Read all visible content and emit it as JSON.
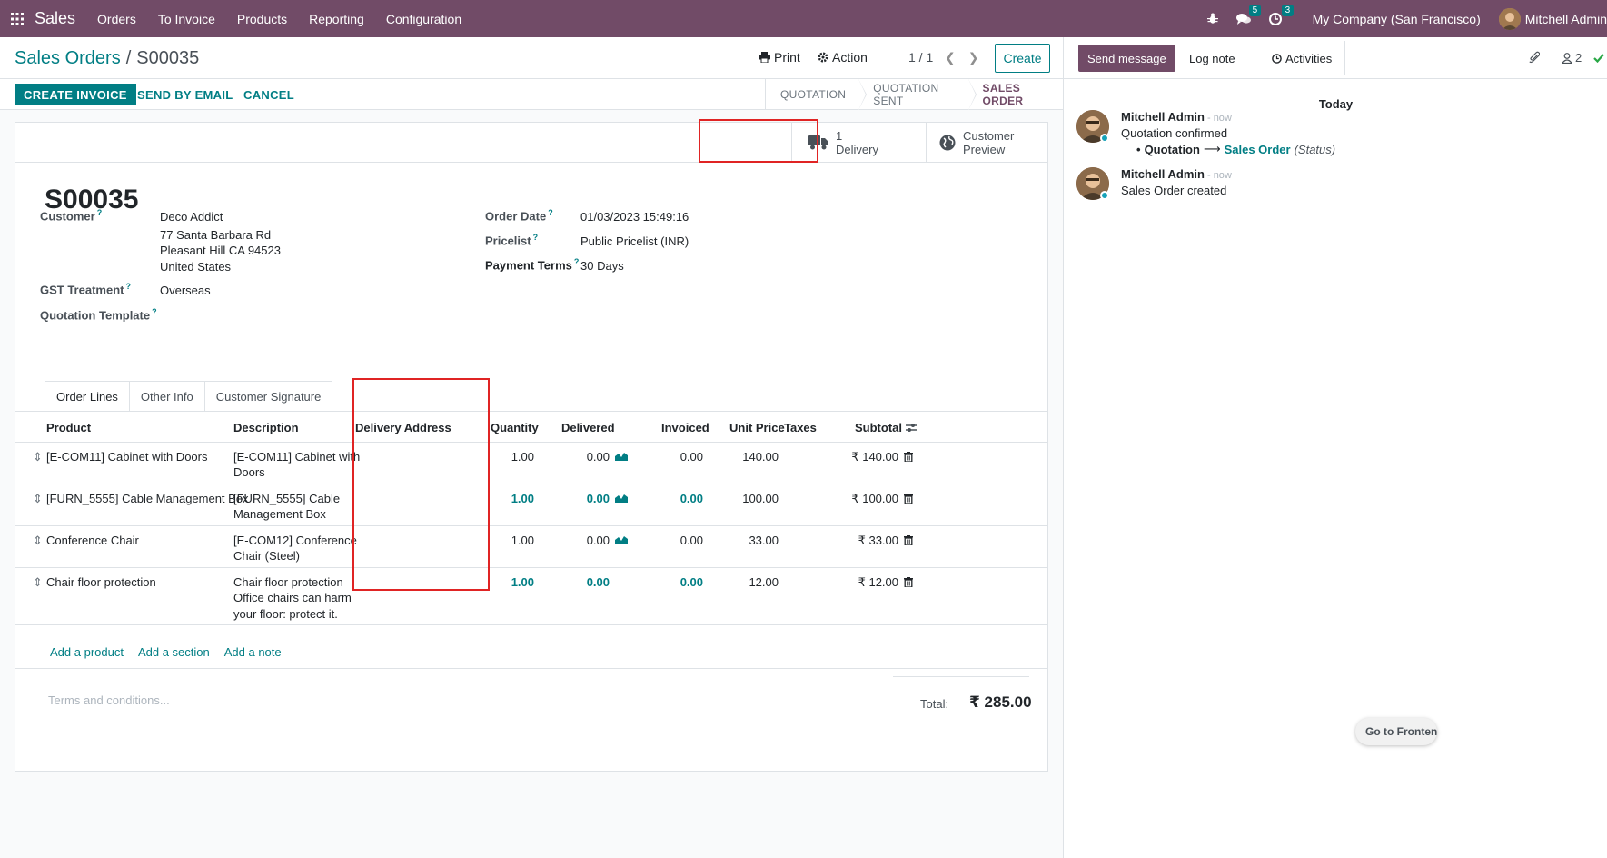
{
  "navbar": {
    "app_name": "Sales",
    "menu": [
      "Orders",
      "To Invoice",
      "Products",
      "Reporting",
      "Configuration"
    ],
    "messages_count": "5",
    "activities_count": "3",
    "company": "My Company (San Francisco)",
    "user": "Mitchell Admin",
    "brand_color": "#714b67"
  },
  "control_panel": {
    "breadcrumb_parent": "Sales Orders",
    "breadcrumb_sep": "/",
    "breadcrumb_current": "S00035",
    "print_label": "Print",
    "action_label": "Action",
    "pager": "1 / 1",
    "create_label": "Create"
  },
  "statusbar": {
    "create_invoice": "CREATE INVOICE",
    "send_by_email": "SEND BY EMAIL",
    "cancel": "CANCEL",
    "stages": [
      "QUOTATION",
      "QUOTATION SENT",
      "SALES ORDER"
    ],
    "active_stage": "SALES ORDER"
  },
  "smart_buttons": {
    "delivery_count": "1",
    "delivery_label": "Delivery",
    "preview_line1": "Customer",
    "preview_line2": "Preview"
  },
  "form": {
    "order_name": "S00035",
    "customer_label": "Customer",
    "customer_name": "Deco Addict",
    "address_line1": "77 Santa Barbara Rd",
    "address_line2": "Pleasant Hill CA 94523",
    "address_line3": "United States",
    "gst_label": "GST Treatment",
    "gst_value": "Overseas",
    "template_label": "Quotation Template",
    "order_date_label": "Order Date",
    "order_date_value": "01/03/2023 15:49:16",
    "pricelist_label": "Pricelist",
    "pricelist_value": "Public Pricelist (INR)",
    "payment_terms_label": "Payment Terms",
    "payment_terms_value": "30 Days",
    "help_mark": "?"
  },
  "tabs": [
    "Order Lines",
    "Other Info",
    "Customer Signature"
  ],
  "table": {
    "headers": {
      "product": "Product",
      "description": "Description",
      "delivery_address": "Delivery Address",
      "quantity": "Quantity",
      "delivered": "Delivered",
      "invoiced": "Invoiced",
      "unit_price": "Unit Price",
      "taxes": "Taxes",
      "subtotal": "Subtotal"
    },
    "rows": [
      {
        "product": "[E-COM11] Cabinet with Doors",
        "desc1": "[E-COM11] Cabinet with",
        "desc2": "Doors",
        "desc3": "",
        "quantity": "1.00",
        "delivered": "0.00",
        "invoiced": "0.00",
        "unit_price": "140.00",
        "subtotal": "₹ 140.00"
      },
      {
        "product": "[FURN_5555] Cable Management Box",
        "desc1": "[FURN_5555] Cable",
        "desc2": "Management Box",
        "desc3": "",
        "quantity": "1.00",
        "delivered": "0.00",
        "invoiced": "0.00",
        "unit_price": "100.00",
        "subtotal": "₹ 100.00"
      },
      {
        "product": "Conference Chair",
        "desc1": "[E-COM12] Conference",
        "desc2": "Chair (Steel)",
        "desc3": "",
        "quantity": "1.00",
        "delivered": "0.00",
        "invoiced": "0.00",
        "unit_price": "33.00",
        "subtotal": "₹ 33.00"
      },
      {
        "product": "Chair floor protection",
        "desc1": "Chair floor protection",
        "desc2": "Office chairs can harm",
        "desc3": "your floor: protect it.",
        "quantity": "1.00",
        "delivered": "0.00",
        "invoiced": "0.00",
        "unit_price": "12.00",
        "subtotal": "₹ 12.00"
      }
    ],
    "add_product": "Add a product",
    "add_section": "Add a section",
    "add_note": "Add a note"
  },
  "footer": {
    "terms_placeholder": "Terms and conditions...",
    "total_label": "Total:",
    "total_value": "₹ 285.00"
  },
  "chatter": {
    "send_message": "Send message",
    "log_note": "Log note",
    "activities": "Activities",
    "followers_count": "2",
    "today": "Today",
    "messages": [
      {
        "author": "Mitchell Admin",
        "time": "- now",
        "body": "Quotation confirmed",
        "track_from": "Quotation",
        "track_to": "Sales Order",
        "track_field": "(Status)"
      },
      {
        "author": "Mitchell Admin",
        "time": "- now",
        "body": "Sales Order created"
      }
    ],
    "go_frontend": "Go to Frontend"
  }
}
